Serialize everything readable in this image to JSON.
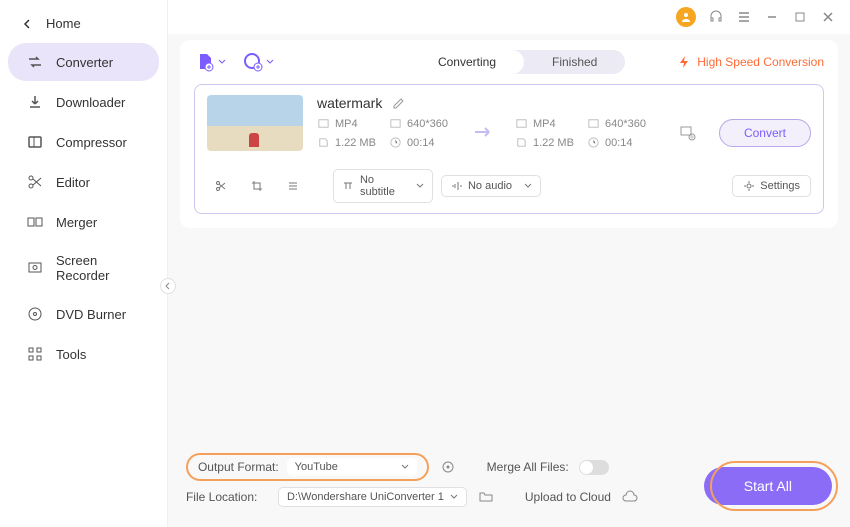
{
  "nav": {
    "back": "Home",
    "items": [
      {
        "label": "Converter",
        "active": true
      },
      {
        "label": "Downloader"
      },
      {
        "label": "Compressor"
      },
      {
        "label": "Editor"
      },
      {
        "label": "Merger"
      },
      {
        "label": "Screen Recorder"
      },
      {
        "label": "DVD Burner"
      },
      {
        "label": "Tools"
      }
    ]
  },
  "tabs": {
    "converting": "Converting",
    "finished": "Finished"
  },
  "hsc": "High Speed Conversion",
  "file": {
    "name": "watermark",
    "src": {
      "format": "MP4",
      "res": "640*360",
      "size": "1.22 MB",
      "dur": "00:14"
    },
    "dst": {
      "format": "MP4",
      "res": "640*360",
      "size": "1.22 MB",
      "dur": "00:14"
    },
    "subtitle": "No subtitle",
    "audio": "No audio",
    "settings": "Settings",
    "convert": "Convert"
  },
  "footer": {
    "output_label": "Output Format:",
    "output_value": "YouTube",
    "location_label": "File Location:",
    "location_value": "D:\\Wondershare UniConverter 1",
    "merge_label": "Merge All Files:",
    "upload_label": "Upload to Cloud",
    "start": "Start All"
  }
}
